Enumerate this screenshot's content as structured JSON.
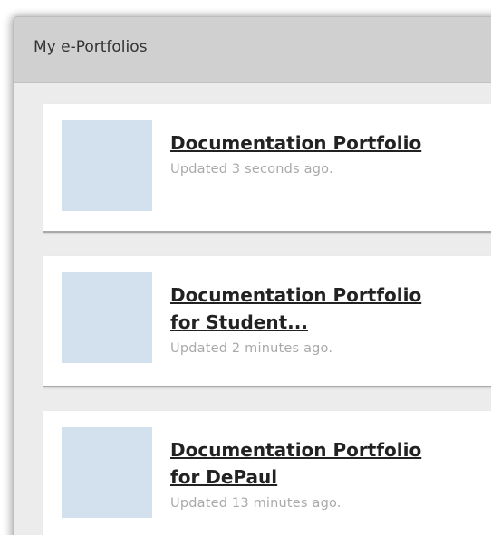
{
  "widget": {
    "title": "My e-Portfolios"
  },
  "portfolios": [
    {
      "title": "Documentation Portfolio",
      "updated": "Updated 3 seconds ago."
    },
    {
      "title_line1": "Documentation Portfolio",
      "title_line2": "for Student...",
      "updated": "Updated 2 minutes ago."
    },
    {
      "title_line1": "Documentation Portfolio",
      "title_line2": "for DePaul",
      "updated": "Updated 13 minutes ago."
    }
  ],
  "colors": {
    "header_bg": "#d0d0d0",
    "panel_bg": "#ececec",
    "thumbnail": "#d3e1ef",
    "updated_text": "#a9a9a9"
  }
}
